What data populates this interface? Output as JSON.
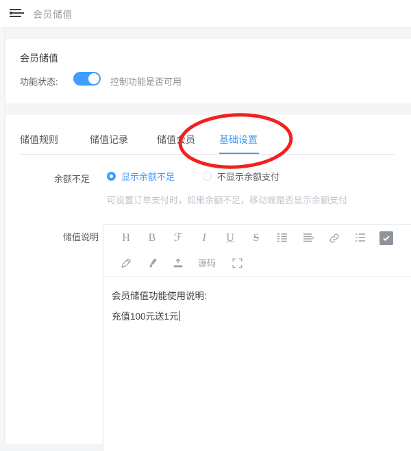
{
  "topbar": {
    "collapse_icon": "menu-collapse-icon",
    "title": "会员储值"
  },
  "status_card": {
    "title": "会员储值",
    "label": "功能状态:",
    "toggle_on": true,
    "description": "控制功能是否可用",
    "accent_color": "#409eff"
  },
  "tabs": [
    {
      "label": "储值规则",
      "active": false
    },
    {
      "label": "储值记录",
      "active": false
    },
    {
      "label": "储值会员",
      "active": false
    },
    {
      "label": "基础设置",
      "active": true
    }
  ],
  "balance_field": {
    "label": "余额不足",
    "options": [
      {
        "label": "显示余额不足",
        "checked": true
      },
      {
        "label": "不显示余额支付",
        "checked": false
      }
    ],
    "hint": "可设置订单支付时，如果余额不足，移动端是否显示余额支付"
  },
  "editor_field": {
    "label": "储值说明",
    "toolbar_row1": [
      {
        "name": "heading-icon",
        "glyph": "H"
      },
      {
        "name": "bold-icon",
        "glyph": "B"
      },
      {
        "name": "font-family-icon",
        "glyph": "ℱ"
      },
      {
        "name": "italic-icon",
        "glyph": "I"
      },
      {
        "name": "underline-icon",
        "glyph": "U"
      },
      {
        "name": "strikethrough-icon",
        "glyph": "S"
      },
      {
        "name": "indent-icon",
        "glyph": ""
      },
      {
        "name": "align-icon",
        "glyph": ""
      },
      {
        "name": "link-icon",
        "glyph": ""
      },
      {
        "name": "unordered-list-icon",
        "glyph": ""
      },
      {
        "name": "checkbox-icon",
        "glyph": ""
      }
    ],
    "toolbar_row2": [
      {
        "name": "eraser-icon",
        "glyph": ""
      },
      {
        "name": "brush-icon",
        "glyph": ""
      },
      {
        "name": "upload-icon",
        "glyph": ""
      },
      {
        "name": "source-code-button",
        "glyph": "源码"
      },
      {
        "name": "fullscreen-icon",
        "glyph": ""
      }
    ],
    "content_lines": [
      "会员储值功能使用说明:",
      "充值100元送1元"
    ]
  },
  "annotation": {
    "shape": "ellipse",
    "color": "#f42020",
    "target": "基础设置"
  }
}
